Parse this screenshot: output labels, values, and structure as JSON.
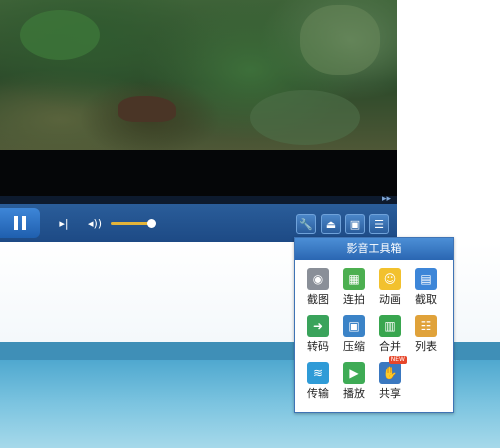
{
  "player": {
    "seek_ff": "▸▸",
    "play_symbol": "pause",
    "next_symbol": "▸|",
    "volume_symbol": "◂))",
    "volume_level": 0.85
  },
  "toolbar": {
    "tools": "🔧",
    "eject": "⏏",
    "skin": "▣",
    "playlist": "☰"
  },
  "toolbox": {
    "title": "影音工具箱",
    "items": [
      {
        "label": "截图",
        "icon": "camera-icon",
        "color": "#8a8f98"
      },
      {
        "label": "连拍",
        "icon": "burst-icon",
        "color": "#4caf50"
      },
      {
        "label": "动画",
        "icon": "gif-icon",
        "color": "#f2c12e"
      },
      {
        "label": "截取",
        "icon": "film-cut-icon",
        "color": "#3d86d8"
      },
      {
        "label": "转码",
        "icon": "convert-icon",
        "color": "#3aa35b"
      },
      {
        "label": "压缩",
        "icon": "compress-icon",
        "color": "#3b83c7"
      },
      {
        "label": "合并",
        "icon": "merge-icon",
        "color": "#39a64f"
      },
      {
        "label": "列表",
        "icon": "list-gear-icon",
        "color": "#e0a23a"
      },
      {
        "label": "传输",
        "icon": "wifi-icon",
        "color": "#2f9bd7"
      },
      {
        "label": "播放",
        "icon": "play-cloud-icon",
        "color": "#3eab55"
      },
      {
        "label": "共享",
        "icon": "share-icon",
        "color": "#3a78c0",
        "badge": "NEW"
      }
    ]
  }
}
